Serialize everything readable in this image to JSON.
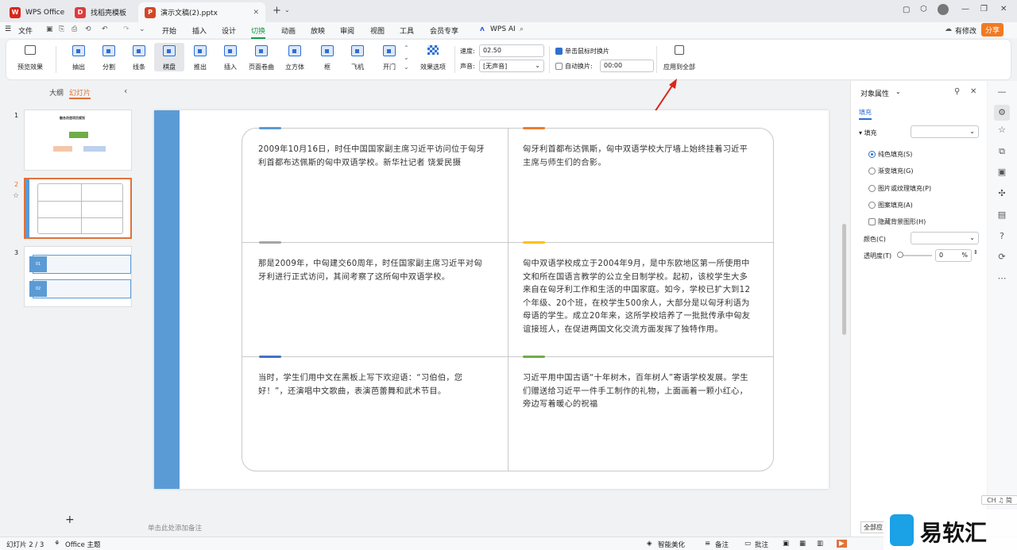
{
  "tabs": [
    {
      "label": "WPS Office",
      "logo": "W"
    },
    {
      "label": "找稻壳模板",
      "logo": "D"
    },
    {
      "label": "演示文稿(2).pptx",
      "logo": "P"
    }
  ],
  "menu": {
    "file": "文件",
    "items": [
      "开始",
      "插入",
      "设计",
      "切换",
      "动画",
      "放映",
      "审阅",
      "视图",
      "工具",
      "会员专享"
    ],
    "active": "切换",
    "wps_ai": "WPS AI",
    "has_edit": "有修改",
    "share": "分享"
  },
  "ribbon": {
    "preview": "预览效果",
    "effects": [
      "抽出",
      "分割",
      "线条",
      "棋盘",
      "推出",
      "插入",
      "页面卷曲",
      "立方体",
      "框",
      "飞机",
      "开门"
    ],
    "selected_effect": "棋盘",
    "effect_options": "效果选项",
    "speed_label": "速度:",
    "speed_value": "02.50",
    "sound_label": "声音:",
    "sound_value": "[无声音]",
    "click_switch": "单击鼠标时换片",
    "auto_switch": "自动换片:",
    "auto_time": "00:00",
    "apply_all": "应用到全部"
  },
  "left_panel": {
    "outline_tab": "大纲",
    "slides_tab": "幻灯片",
    "slide_numbers": [
      "1",
      "2",
      "3"
    ],
    "thumb1_title": "融合改造项目规划",
    "thumb3_items": [
      "01",
      "02"
    ]
  },
  "slide": {
    "cells": [
      {
        "text": "2009年10月16日，时任中国国家副主席习近平访问位于匈牙利首都布达佩斯的匈中双语学校。新华社记者 饶爱民摄",
        "color": "#5b9bd5"
      },
      {
        "text": "匈牙利首都布达佩斯，匈中双语学校大厅墙上始终挂着习近平主席与师生们的合影。",
        "color": "#ed7d31"
      },
      {
        "text": "那是2009年，中匈建交60周年，时任国家副主席习近平对匈牙利进行正式访问，其间考察了这所匈中双语学校。",
        "color": "#a5a5a5"
      },
      {
        "text": "匈中双语学校成立于2004年9月，是中东欧地区第一所使用中文和所在国语言教学的公立全日制学校。起初，该校学生大多来自在匈牙利工作和生活的中国家庭。如今，学校已扩大到12个年级、20个班，在校学生500余人，大部分是以匈牙利语为母语的学生。成立20年来，这所学校培养了一批批传承中匈友谊接班人，在促进两国文化交流方面发挥了独特作用。",
        "color": "#ffc000"
      },
      {
        "text": "当时，学生们用中文在黑板上写下欢迎语：“习伯伯，您好！”，还演唱中文歌曲，表演芭蕾舞和武术节目。",
        "color": "#4472c4"
      },
      {
        "text": "习近平用中国古语“十年树木，百年树人”寄语学校发展。学生们赠送给习近平一件手工制作的礼物，上面画着一颗小红心，旁边写着暖心的祝福",
        "color": "#70ad47"
      }
    ]
  },
  "notes_placeholder": "单击此处添加备注",
  "right_panel": {
    "title": "对象属性",
    "fill_tab": "填充",
    "fill_section": "填充",
    "options": [
      "纯色填充(S)",
      "渐变填充(G)",
      "图片或纹理填充(P)",
      "图案填充(A)"
    ],
    "hide_bg": "隐藏背景图形(H)",
    "color_label": "颜色(C)",
    "transparency_label": "透明度(T)",
    "transparency_value": "0",
    "percent": "%",
    "apply_all_short": "全部应"
  },
  "status": {
    "slide_info": "幻灯片 2 / 3",
    "theme": "Office 主题",
    "smart": "智能美化",
    "notes": "备注",
    "comments": "批注",
    "ime": "CH ♫ 简"
  },
  "watermark": "易软汇"
}
